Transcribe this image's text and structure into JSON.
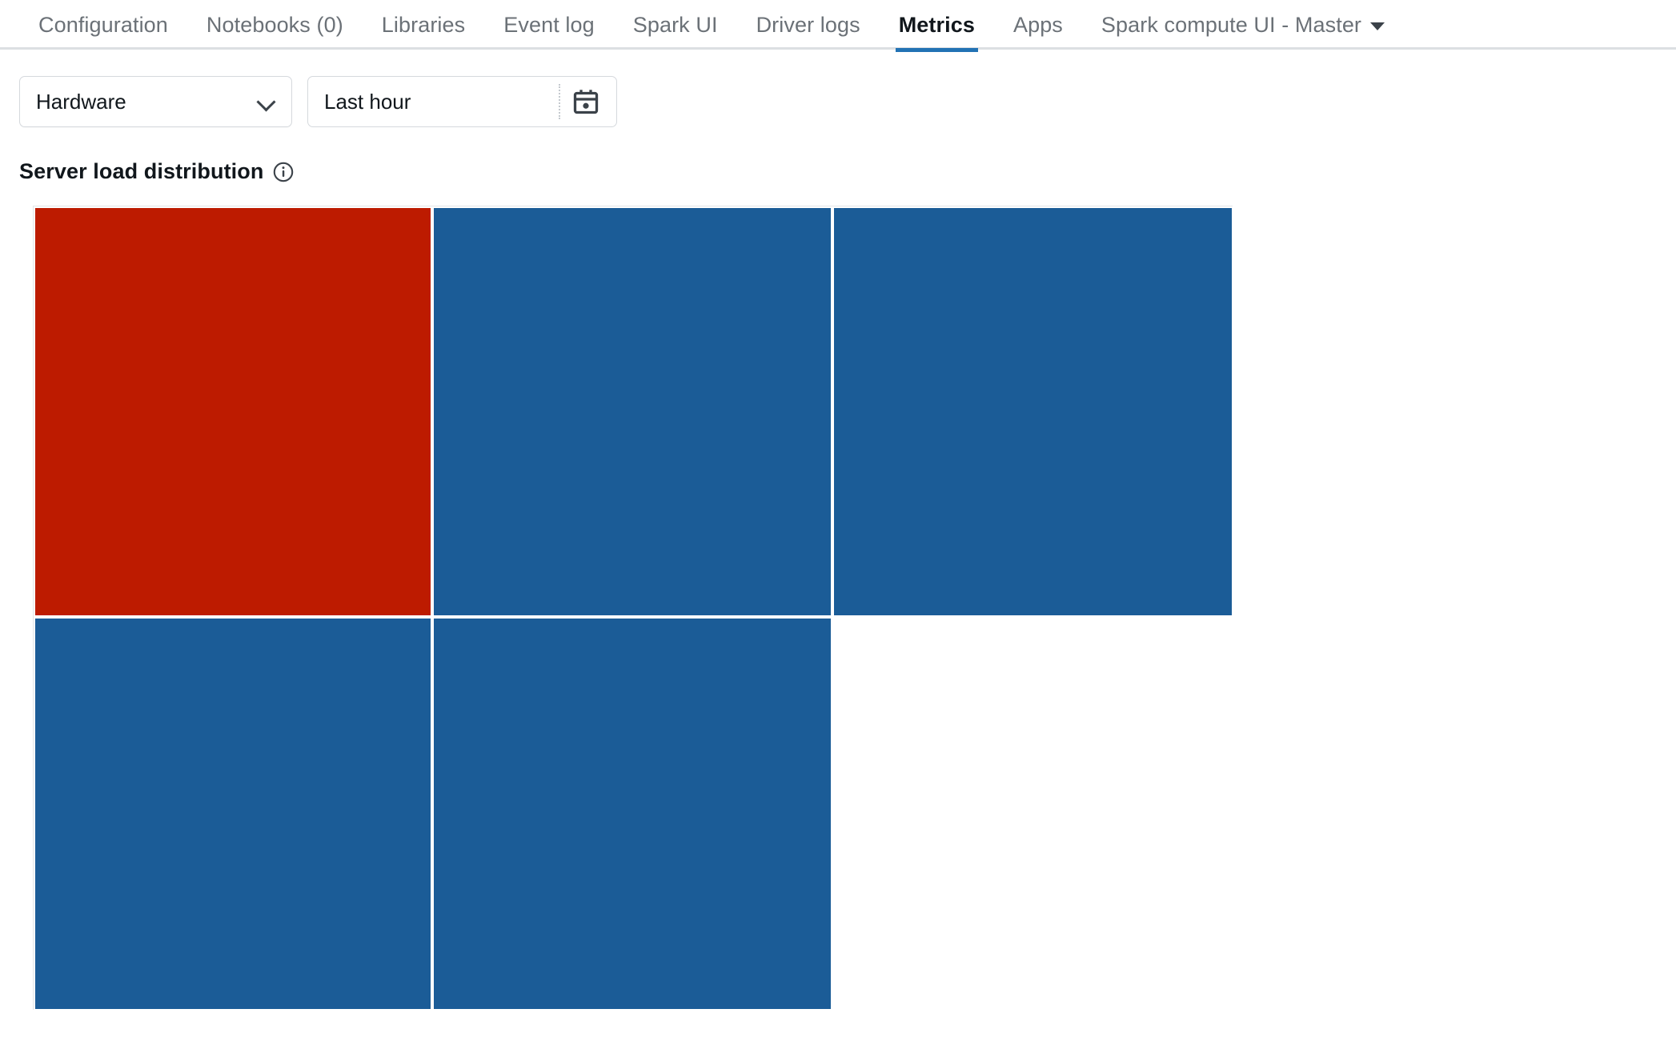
{
  "tabs": [
    {
      "label": "Configuration",
      "active": false,
      "caret": false
    },
    {
      "label": "Notebooks (0)",
      "active": false,
      "caret": false
    },
    {
      "label": "Libraries",
      "active": false,
      "caret": false
    },
    {
      "label": "Event log",
      "active": false,
      "caret": false
    },
    {
      "label": "Spark UI",
      "active": false,
      "caret": false
    },
    {
      "label": "Driver logs",
      "active": false,
      "caret": false
    },
    {
      "label": "Metrics",
      "active": true,
      "caret": false
    },
    {
      "label": "Apps",
      "active": false,
      "caret": false
    },
    {
      "label": "Spark compute UI - Master",
      "active": false,
      "caret": true
    }
  ],
  "filters": {
    "metric_group": {
      "value": "Hardware",
      "icon": "chevron-down-icon"
    },
    "time_range": {
      "value": "Last hour",
      "icon": "calendar-icon"
    }
  },
  "section": {
    "title": "Server load distribution",
    "info_icon": "info-circle-icon"
  },
  "colors": {
    "accent_blue": "#2272b4",
    "tile_blue": "#1b5c97",
    "tile_red": "#bd1b00",
    "tab_inactive": "#6b7177",
    "tab_active": "#11171c",
    "border": "#dcdfe2"
  },
  "chart_data": {
    "type": "treemap",
    "title": "Server load distribution",
    "xlabel": "",
    "ylabel": "",
    "grid": false,
    "legend": "none",
    "columns": 3,
    "rows": 2,
    "cells": [
      {
        "index": 0,
        "row": 0,
        "col": 0,
        "color": "#bd1b00",
        "value": 1,
        "state": "high-load",
        "width_pct": 33.2,
        "height_pct": 51.0
      },
      {
        "index": 1,
        "row": 0,
        "col": 1,
        "color": "#1b5c97",
        "value": 1,
        "state": "normal",
        "width_pct": 33.4,
        "height_pct": 51.0
      },
      {
        "index": 2,
        "row": 0,
        "col": 2,
        "color": "#1b5c97",
        "value": 1,
        "state": "normal",
        "width_pct": 33.4,
        "height_pct": 51.0
      },
      {
        "index": 3,
        "row": 1,
        "col": 0,
        "color": "#1b5c97",
        "value": 1,
        "state": "normal",
        "width_pct": 33.2,
        "height_pct": 49.0
      },
      {
        "index": 4,
        "row": 1,
        "col": 1,
        "color": "#1b5c97",
        "value": 1,
        "state": "normal",
        "width_pct": 33.4,
        "height_pct": 49.0
      },
      {
        "index": 5,
        "row": 1,
        "col": 2,
        "color": "#ffffff",
        "value": 0,
        "state": "empty",
        "width_pct": 33.4,
        "height_pct": 49.0
      }
    ]
  }
}
